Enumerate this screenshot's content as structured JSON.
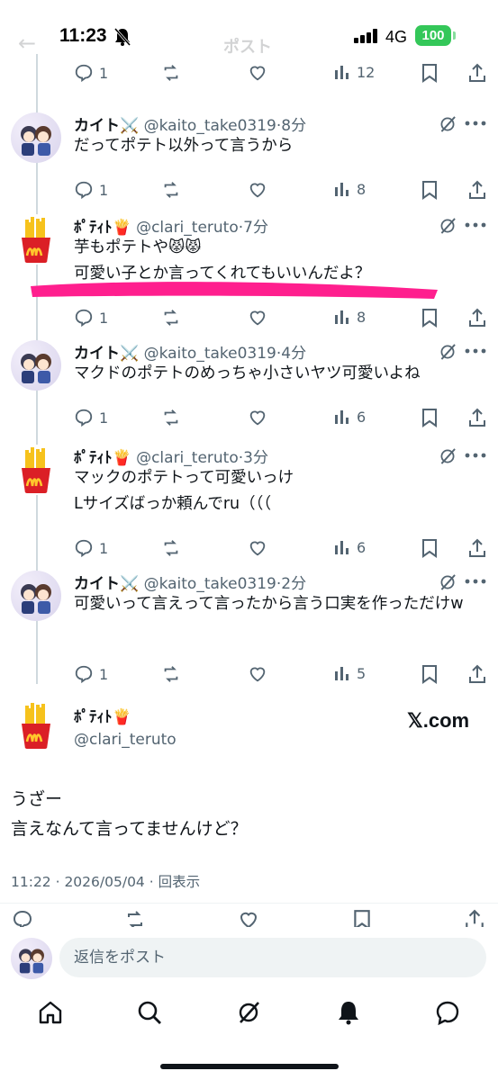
{
  "status_bar": {
    "time": "11:23",
    "network": "4G",
    "battery": "100"
  },
  "header": {
    "back": "←",
    "title": "ポスト"
  },
  "tweets": [
    {
      "name": "カイト⚔️",
      "handle": "@kaito_take0319",
      "time": "8分",
      "text": "だってポテト以外って言うから",
      "replies": "1",
      "views": "8"
    },
    {
      "name": "ﾎﾟﾃｨﾄ🍟",
      "handle": "@clari_teruto",
      "time": "7分",
      "text": "芋もポテトや😾😾\n可愛い子とか言ってくれてもいいんだよ？",
      "replies": "1",
      "views": "8"
    },
    {
      "name": "カイト⚔️",
      "handle": "@kaito_take0319",
      "time": "4分",
      "text": "マクドのポテトのめっちゃ小さいヤツ可愛いよね",
      "replies": "1",
      "views": "6"
    },
    {
      "name": "ﾎﾟﾃｨﾄ🍟",
      "handle": "@clari_teruto",
      "time": "3分",
      "text": "マックのポテトって可愛いっけ\nLサイズばっか頼んでru（（（",
      "replies": "1",
      "views": "6"
    },
    {
      "name": "カイト⚔️",
      "handle": "@kaito_take0319",
      "time": "2分",
      "text": "可愛いって言えって言ったから言う口実を作っただけw",
      "replies": "1",
      "views": "5"
    }
  ],
  "top_partial": {
    "replies": "1",
    "views": "12"
  },
  "main_tweet": {
    "name": "ﾎﾟﾃｨﾄ🍟",
    "handle": "@clari_teruto",
    "source": "𝕏.com",
    "text": "うざー\n言えなんて言ってませんけど？",
    "meta": "11:22 · 2026/05/04 · 回表示"
  },
  "reply": {
    "placeholder": "返信をポスト"
  },
  "colors": {
    "accent": "#1d9bf0",
    "marker": "#ff1f8e",
    "muted": "#536471",
    "battery": "#34c759"
  },
  "tabs": [
    "home-icon",
    "search-icon",
    "grok-icon",
    "notifications-icon",
    "messages-icon"
  ]
}
